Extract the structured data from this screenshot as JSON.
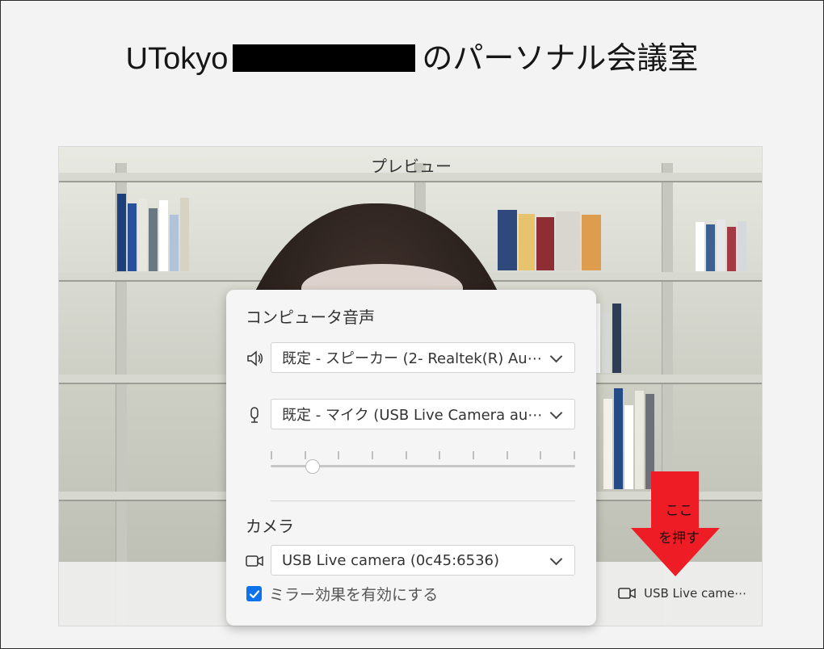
{
  "header": {
    "title_prefix": "UTokyo",
    "title_suffix": "のパーソナル会議室"
  },
  "preview": {
    "label": "プレビュー",
    "camera_indicator": "USB Live came⋯"
  },
  "audio_panel": {
    "title": "コンピュータ音声",
    "speaker_select": "既定 - スピーカー (2- Realtek(R) Au⋯",
    "microphone_select": "既定 - マイク (USB Live Camera au⋯",
    "volume_level": 0.12,
    "camera_title": "カメラ",
    "camera_select": "USB Live camera (0c45:6536)",
    "mirror_label": "ミラー効果を有効にする",
    "mirror_checked": true
  },
  "annotation": {
    "line1": "ここ",
    "line2": "を押す",
    "color": "#ee1c25"
  },
  "colors": {
    "accent": "#0e72ed",
    "redaction": "#000000"
  },
  "icons": {
    "speaker": "speaker-icon",
    "microphone": "microphone-icon",
    "camera": "camera-icon",
    "chevron": "chevron-down-icon",
    "check": "checkmark-icon"
  }
}
